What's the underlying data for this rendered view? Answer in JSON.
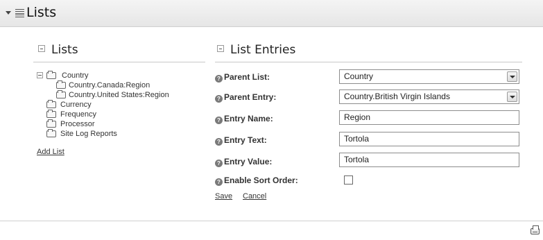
{
  "header": {
    "title": "Lists"
  },
  "lists_panel": {
    "heading": "Lists",
    "tree": {
      "root": "Country",
      "children": [
        "Country.Canada:Region",
        "Country.United States:Region"
      ],
      "siblings": [
        "Currency",
        "Frequency",
        "Processor",
        "Site Log Reports"
      ]
    },
    "add_list_label": "Add List"
  },
  "entries_panel": {
    "heading": "List Entries",
    "parent_list": {
      "label": "Parent List:",
      "value": "Country"
    },
    "parent_entry": {
      "label": "Parent Entry:",
      "value": "Country.British Virgin Islands"
    },
    "entry_name": {
      "label": "Entry Name:",
      "value": "Region"
    },
    "entry_text": {
      "label": "Entry Text:",
      "value": "Tortola"
    },
    "entry_value": {
      "label": "Entry Value:",
      "value": "Tortola"
    },
    "enable_sort_order": {
      "label": "Enable Sort Order:",
      "checked": false
    },
    "save_label": "Save",
    "cancel_label": "Cancel"
  },
  "icons": {
    "collapse": "triangle-down-icon",
    "menu": "list-icon",
    "help": "help-icon",
    "folder": "folder-icon",
    "print": "print-icon"
  }
}
